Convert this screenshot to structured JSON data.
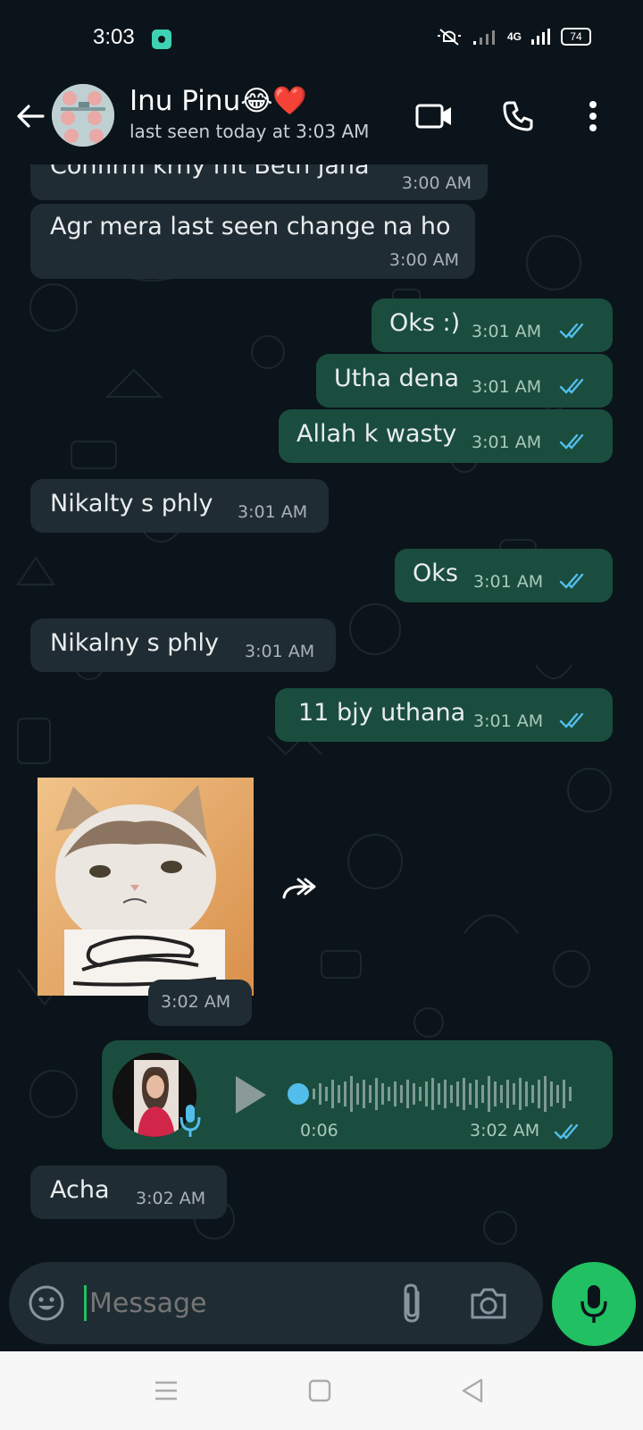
{
  "status_bar": {
    "time": "3:03",
    "network": "4G",
    "battery": "74"
  },
  "header": {
    "contact_name": "Inu Pinu😂❤️",
    "last_seen": "last seen today at 3:03 AM",
    "icons": {
      "back": "arrow-left-icon",
      "video": "video-call-icon",
      "call": "phone-icon",
      "menu": "more-vert-icon"
    }
  },
  "messages": [
    {
      "direction": "in",
      "text": "Confirm krny mt Beth jana",
      "time": "3:00 AM"
    },
    {
      "direction": "in",
      "text": "Agr mera last seen change na ho",
      "time": "3:00 AM"
    },
    {
      "direction": "out",
      "text": "Oks :)",
      "time": "3:01 AM",
      "read": true
    },
    {
      "direction": "out",
      "text": "Utha dena",
      "time": "3:01 AM",
      "read": true
    },
    {
      "direction": "out",
      "text": "Allah k wasty",
      "time": "3:01 AM",
      "read": true
    },
    {
      "direction": "in",
      "text": "Nikalty s phly",
      "time": "3:01 AM"
    },
    {
      "direction": "out",
      "text": "Oks",
      "time": "3:01 AM",
      "read": true
    },
    {
      "direction": "in",
      "text": "Nikalny s phly",
      "time": "3:01 AM"
    },
    {
      "direction": "out",
      "text": "11 bjy uthana",
      "time": "3:01 AM",
      "read": true
    },
    {
      "direction": "in",
      "type": "sticker",
      "time": "3:02 AM"
    },
    {
      "direction": "out",
      "type": "voice",
      "duration": "0:06",
      "time": "3:02 AM",
      "read": true
    },
    {
      "direction": "in",
      "text": "Acha",
      "time": "3:02 AM"
    }
  ],
  "input": {
    "placeholder": "Message",
    "icons": {
      "emoji": "emoji-icon",
      "attach": "paperclip-icon",
      "camera": "camera-icon",
      "mic": "microphone-icon"
    }
  },
  "colors": {
    "background": "#0b141a",
    "incoming_bubble": "#202c33",
    "outgoing_bubble": "#1a4d3d",
    "accent": "#21c063",
    "read_ticks": "#53bdeb"
  }
}
